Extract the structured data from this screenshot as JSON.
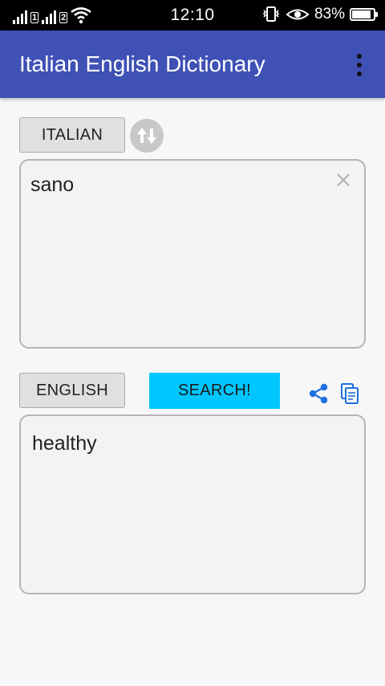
{
  "status_bar": {
    "sim1_label": "1",
    "sim2_label": "2",
    "time": "12:10",
    "battery_text": "83%",
    "battery_level": 0.83,
    "icons": [
      "signal-icon",
      "signal-icon",
      "wifi-icon",
      "vibrate-icon",
      "eye-icon",
      "battery-icon"
    ]
  },
  "app_bar": {
    "title": "Italian English Dictionary",
    "menu_icon": "overflow-menu-icon",
    "color": "#3f51b5"
  },
  "source": {
    "language_label": "ITALIAN",
    "input_text": "sano",
    "clear_icon": "close-icon",
    "swap_icon": "swap-icon"
  },
  "target": {
    "language_label": "ENGLISH",
    "search_label": "SEARCH!",
    "search_color": "#00c6ff",
    "output_text": "healthy",
    "share_icon": "share-icon",
    "copy_icon": "copy-icon",
    "icon_color": "#1e6fe0"
  }
}
